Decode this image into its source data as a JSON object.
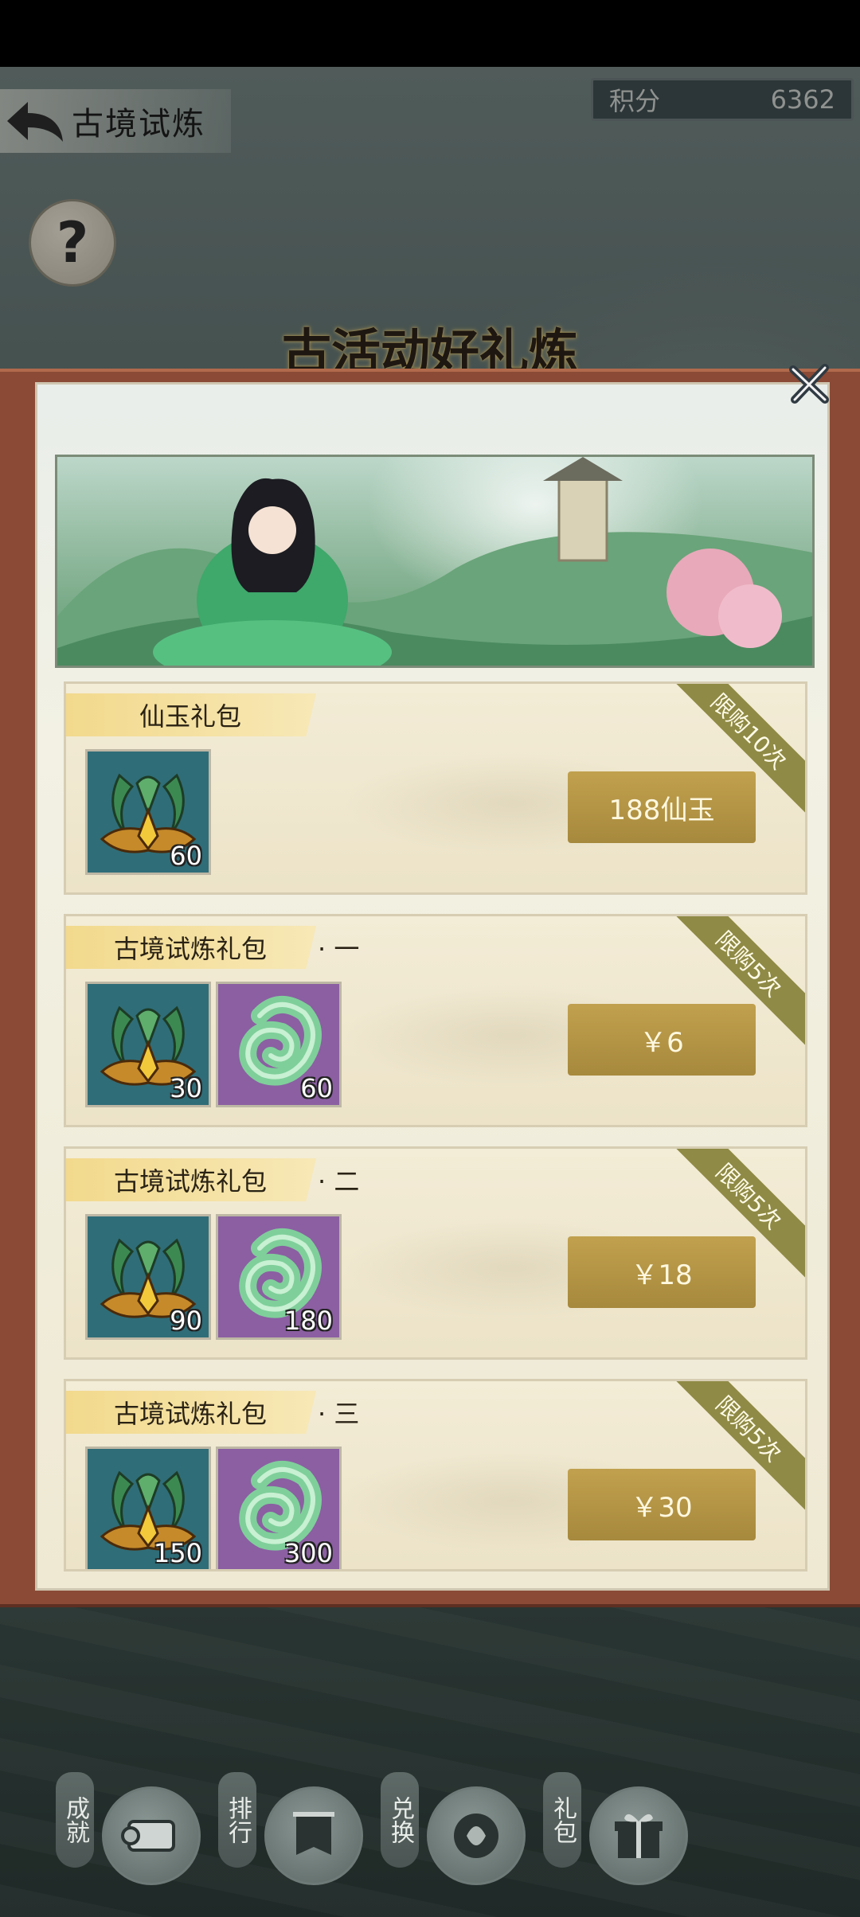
{
  "header": {
    "title": "古境试炼",
    "score_label": "积分",
    "score_value": "6362",
    "help_glyph": "?",
    "banner_title": "古活动好礼炼"
  },
  "modal": {
    "packs": [
      {
        "title": "仙玉礼包",
        "suffix": "",
        "limit": "限购10次",
        "price": "188仙玉",
        "items": [
          {
            "icon": "jade-crown-icon",
            "count": "60",
            "color": "teal"
          }
        ]
      },
      {
        "title": "古境试炼礼包",
        "suffix": "· 一",
        "limit": "限购5次",
        "price": "￥6",
        "items": [
          {
            "icon": "jade-crown-icon",
            "count": "30",
            "color": "teal"
          },
          {
            "icon": "jade-swirl-icon",
            "count": "60",
            "color": "purple"
          }
        ]
      },
      {
        "title": "古境试炼礼包",
        "suffix": "· 二",
        "limit": "限购5次",
        "price": "￥18",
        "items": [
          {
            "icon": "jade-crown-icon",
            "count": "90",
            "color": "teal"
          },
          {
            "icon": "jade-swirl-icon",
            "count": "180",
            "color": "purple"
          }
        ]
      },
      {
        "title": "古境试炼礼包",
        "suffix": "· 三",
        "limit": "限购5次",
        "price": "￥30",
        "items": [
          {
            "icon": "jade-crown-icon",
            "count": "150",
            "color": "teal"
          },
          {
            "icon": "jade-swirl-icon",
            "count": "300",
            "color": "purple"
          }
        ]
      }
    ]
  },
  "bottom_nav": [
    {
      "label": "成就",
      "icon": "scroll-icon"
    },
    {
      "label": "排行",
      "icon": "banner-icon"
    },
    {
      "label": "兑换",
      "icon": "jade-emblem-icon"
    },
    {
      "label": "礼包",
      "icon": "gift-icon"
    }
  ],
  "colors": {
    "modal_frame": "#8a4a36",
    "price_button": "#b0913f",
    "limit_ribbon": "#8f8a45",
    "item_teal": "#2f6d78",
    "item_purple": "#8b5fa2"
  }
}
